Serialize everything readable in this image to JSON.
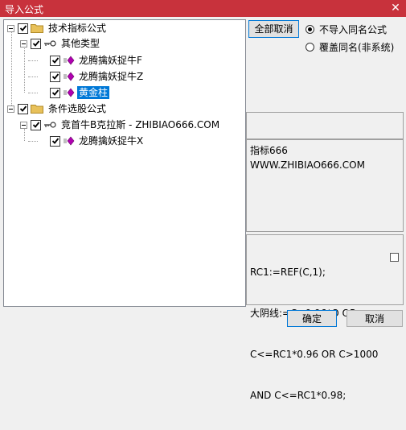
{
  "window": {
    "title": "导入公式",
    "close_glyph": "✕"
  },
  "tree": {
    "nodes": [
      {
        "id": "tech",
        "label": "技术指标公式",
        "checked": true
      },
      {
        "id": "other",
        "label": "其他类型",
        "checked": true
      },
      {
        "id": "f",
        "label": "龙腾擒妖捉牛F",
        "checked": true
      },
      {
        "id": "z",
        "label": "龙腾擒妖捉牛Z",
        "checked": true
      },
      {
        "id": "gold",
        "label": "黄金柱",
        "checked": true,
        "selected": true
      },
      {
        "id": "cond",
        "label": "条件选股公式",
        "checked": true
      },
      {
        "id": "competition",
        "label": "竞首牛B克拉斯 - ZHIBIAO666.COM",
        "checked": true
      },
      {
        "id": "x",
        "label": "龙腾擒妖捉牛X",
        "checked": true
      }
    ]
  },
  "buttons": {
    "cancel_all": "全部取消",
    "ok": "确定",
    "cancel": "取消"
  },
  "options": {
    "no_import": {
      "label": "不导入同名公式",
      "selected": true
    },
    "overwrite": {
      "label": "覆盖同名(非系统)",
      "selected": false
    }
  },
  "description": {
    "line1": "指标666",
    "line2": "WWW.ZHIBIAO666.COM"
  },
  "formula": {
    "line1": "RC1:=REF(C,1);",
    "line2": "大阴线:=C<0.96*O OR",
    "line3": "C<=RC1*0.96 OR C>1000",
    "line4": "AND C<=RC1*0.98;"
  },
  "colors": {
    "titlebar": "#c8323c",
    "selection": "#0078d7",
    "gem": "#b000b0",
    "folder": "#e8c15a"
  }
}
